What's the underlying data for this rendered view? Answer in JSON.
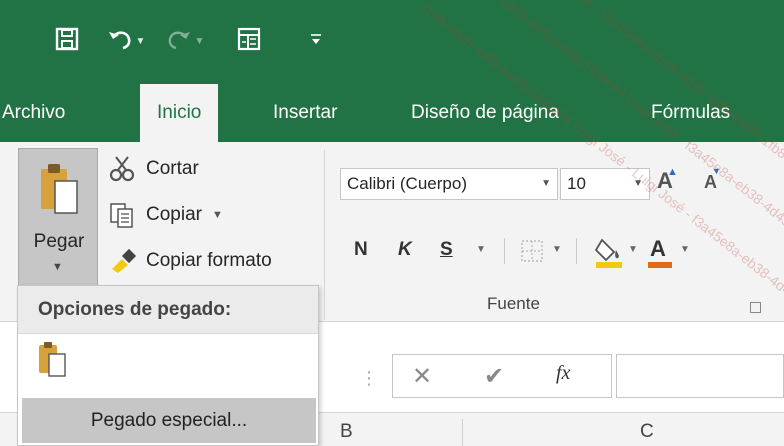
{
  "tabs": [
    {
      "label": "Archivo"
    },
    {
      "label": "Inicio"
    },
    {
      "label": "Insertar"
    },
    {
      "label": "Diseño de página"
    },
    {
      "label": "Fórmulas"
    }
  ],
  "quick_access": {
    "icons": [
      "save-icon",
      "undo-icon",
      "redo-icon",
      "form-icon",
      "customize-qat-icon"
    ]
  },
  "clipboard": {
    "paste_label": "Pegar",
    "cut_label": "Cortar",
    "copy_label": "Copiar",
    "format_painter_label": "Copiar formato"
  },
  "font": {
    "family": "Calibri (Cuerpo)",
    "size": "10",
    "bold": "N",
    "italic": "K",
    "underline": "S",
    "group_label": "Fuente"
  },
  "formula_bar": {
    "fx": "fx"
  },
  "columns": [
    "B",
    "C"
  ],
  "paste_menu": {
    "header": "Opciones de pegado:",
    "item": "Pegado especial..."
  },
  "colors": {
    "excel_green": "#217346",
    "highlight": "#f2c811",
    "font_color": "#e06a1a"
  },
  "watermark_text": "f158-4d45-adf5-ead0c1fb8e84 Luigi José - Luigi José - f3a45e8a-eb38-4d45-adf5-ead0c1f"
}
